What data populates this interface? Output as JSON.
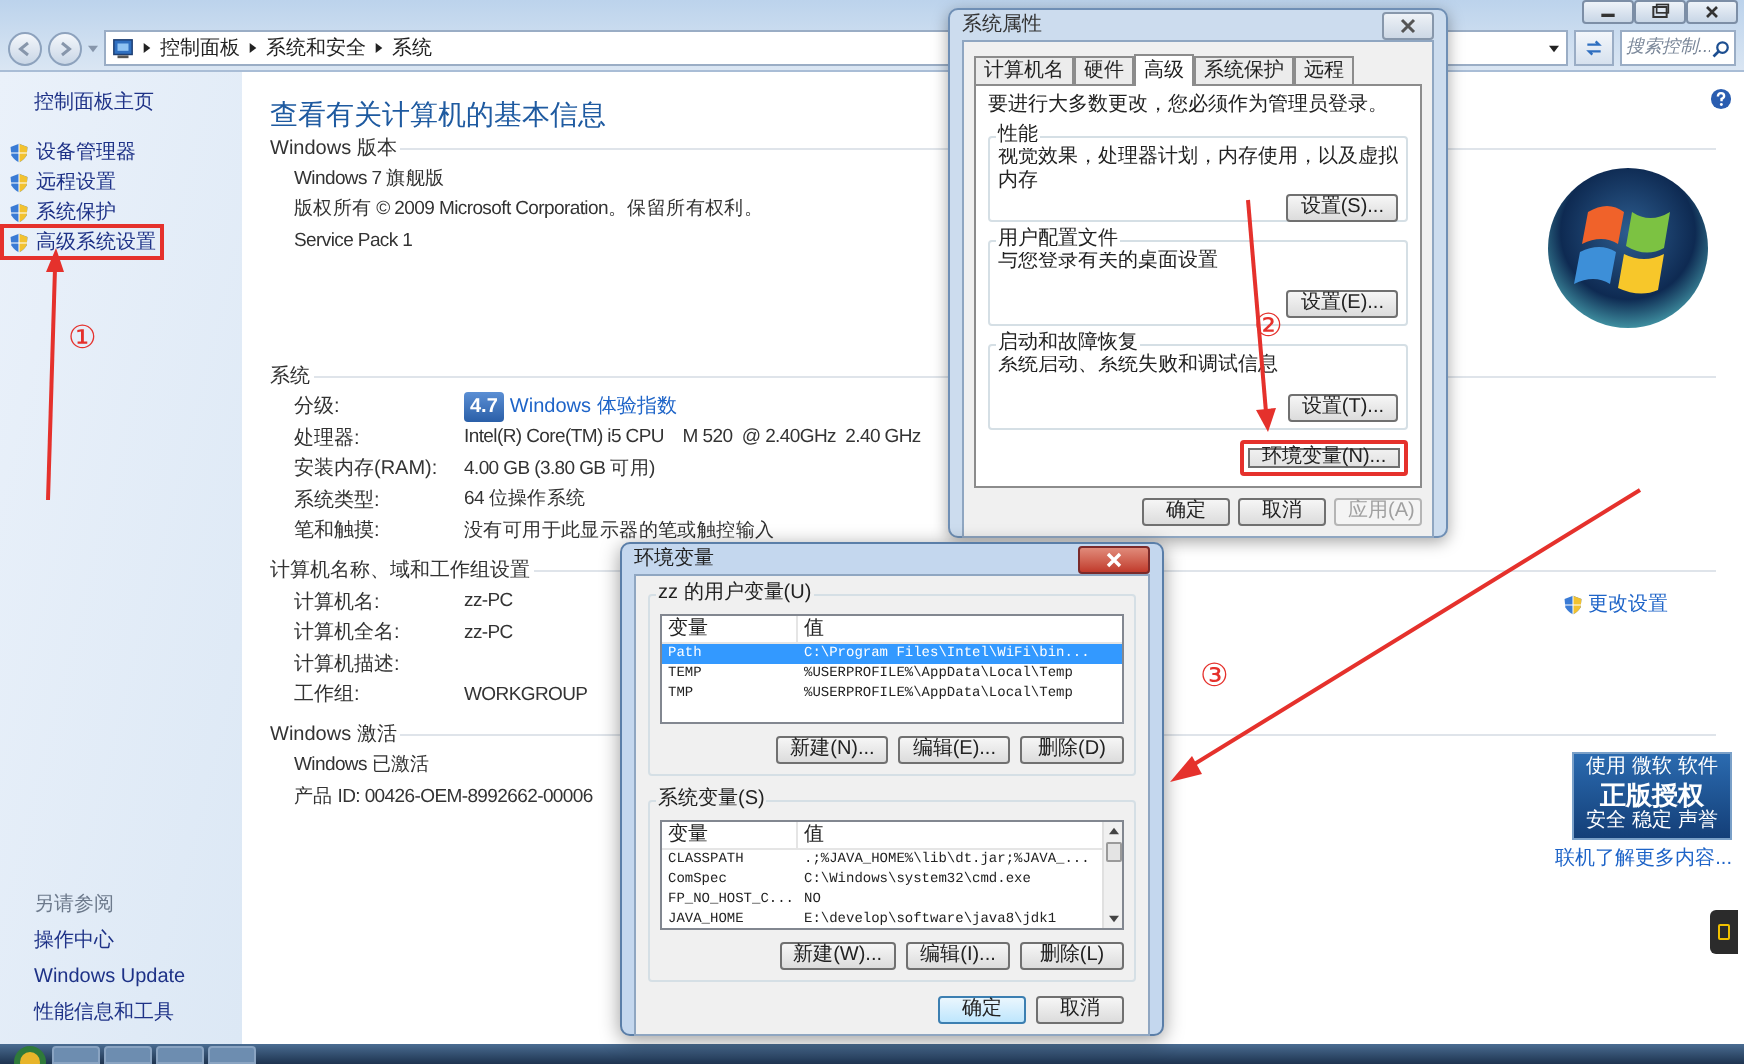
{
  "window": {
    "breadcrumb": [
      "控制面板",
      "系统和安全",
      "系统"
    ],
    "search_placeholder": "搜索控制..."
  },
  "sidebar": {
    "home": "控制面板主页",
    "items": [
      {
        "label": "设备管理器",
        "highlighted": false
      },
      {
        "label": "远程设置",
        "highlighted": false
      },
      {
        "label": "系统保护",
        "highlighted": false
      },
      {
        "label": "高级系统设置",
        "highlighted": true
      }
    ],
    "see_also_title": "另请参阅",
    "see_also": [
      "操作中心",
      "Windows Update",
      "性能信息和工具"
    ]
  },
  "main": {
    "title": "查看有关计算机的基本信息",
    "sections": [
      {
        "title": "Windows 版本",
        "kind": "edition",
        "rows": [
          {
            "value": "Windows 7 旗舰版"
          },
          {
            "value": "版权所有 © 2009 Microsoft Corporation。保留所有权利。"
          },
          {
            "value": "Service Pack 1"
          }
        ]
      },
      {
        "title": "系统",
        "kind": "plain",
        "rows": [
          {
            "label": "分级:",
            "kind": "rating",
            "score": "4.7",
            "value": "Windows 体验指数"
          },
          {
            "label": "处理器:",
            "value": "Intel(R) Core(TM) i5 CPU    M 520  @ 2.40GHz  2.40 GHz"
          },
          {
            "label": "安装内存(RAM):",
            "value": "4.00 GB (3.80 GB 可用)"
          },
          {
            "label": "系统类型:",
            "value": "64 位操作系统"
          },
          {
            "label": "笔和触摸:",
            "value": "没有可用于此显示器的笔或触控输入"
          }
        ]
      },
      {
        "title": "计算机名称、域和工作组设置",
        "kind": "computer",
        "link": "更改设置",
        "rows": [
          {
            "label": "计算机名:",
            "value": "zz-PC"
          },
          {
            "label": "计算机全名:",
            "value": "zz-PC"
          },
          {
            "label": "计算机描述:"
          },
          {
            "label": "工作组:",
            "value": "WORKGROUP"
          }
        ]
      },
      {
        "title": "Windows 激活",
        "kind": "activation",
        "rows": [
          {
            "value": "Windows 已激活"
          },
          {
            "value": "产品 ID: 00426-OEM-8992662-00006"
          }
        ],
        "badge": [
          "使用 微软 软件",
          "正版授权",
          "安全 稳定 声誉"
        ],
        "link": "联机了解更多内容..."
      }
    ]
  },
  "system_properties": {
    "title": "系统属性",
    "tabs": [
      {
        "label": "计算机名",
        "selected": false
      },
      {
        "label": "硬件",
        "selected": false
      },
      {
        "label": "高级",
        "selected": true
      },
      {
        "label": "系统保护",
        "selected": false
      },
      {
        "label": "远程",
        "selected": false
      }
    ],
    "notice": "要进行大多数更改，您必须作为管理员登录。",
    "groups": [
      {
        "title": "性能",
        "description": "视觉效果，处理器计划，内存使用，以及虚拟内存",
        "button": "设置(S)..."
      },
      {
        "title": "用户配置文件",
        "description": "与您登录有关的桌面设置",
        "button": "设置(E)..."
      },
      {
        "title": "启动和故障恢复",
        "description": "系统启动、系统失败和调试信息",
        "button": "设置(T)..."
      }
    ],
    "env_button": {
      "label": "环境变量(N)...",
      "highlighted": true
    },
    "buttons": [
      {
        "label": "确定",
        "disabled": false
      },
      {
        "label": "取消",
        "disabled": false
      },
      {
        "label": "应用(A)",
        "disabled": true
      }
    ]
  },
  "environment_variables": {
    "title": "环境变量",
    "groups": [
      {
        "title": "zz 的用户变量(U)",
        "scrollbar": false,
        "columns": [
          "变量",
          "值"
        ],
        "rows": [
          {
            "name": "Path",
            "value": "C:\\Program Files\\Intel\\WiFi\\bin...",
            "selected": true
          },
          {
            "name": "TEMP",
            "value": "%USERPROFILE%\\AppData\\Local\\Temp",
            "selected": false
          },
          {
            "name": "TMP",
            "value": "%USERPROFILE%\\AppData\\Local\\Temp",
            "selected": false
          }
        ],
        "buttons": [
          "新建(N)...",
          "编辑(E)...",
          "删除(D)"
        ]
      },
      {
        "title": "系统变量(S)",
        "scrollbar": true,
        "columns": [
          "变量",
          "值"
        ],
        "rows": [
          {
            "name": "CLASSPATH",
            "value": ".;%JAVA_HOME%\\lib\\dt.jar;%JAVA_...",
            "selected": false
          },
          {
            "name": "ComSpec",
            "value": "C:\\Windows\\system32\\cmd.exe",
            "selected": false
          },
          {
            "name": "FP_NO_HOST_C...",
            "value": "NO",
            "selected": false
          },
          {
            "name": "JAVA_HOME",
            "value": "E:\\develop\\software\\java8\\jdk1",
            "selected": false
          }
        ],
        "buttons": [
          "新建(W)...",
          "编辑(I)...",
          "删除(L)"
        ]
      }
    ],
    "buttons": [
      {
        "label": "确定",
        "default": true
      },
      {
        "label": "取消",
        "default": false
      }
    ]
  },
  "annotations": [
    {
      "label": "①"
    },
    {
      "label": "②"
    },
    {
      "label": "③"
    }
  ]
}
